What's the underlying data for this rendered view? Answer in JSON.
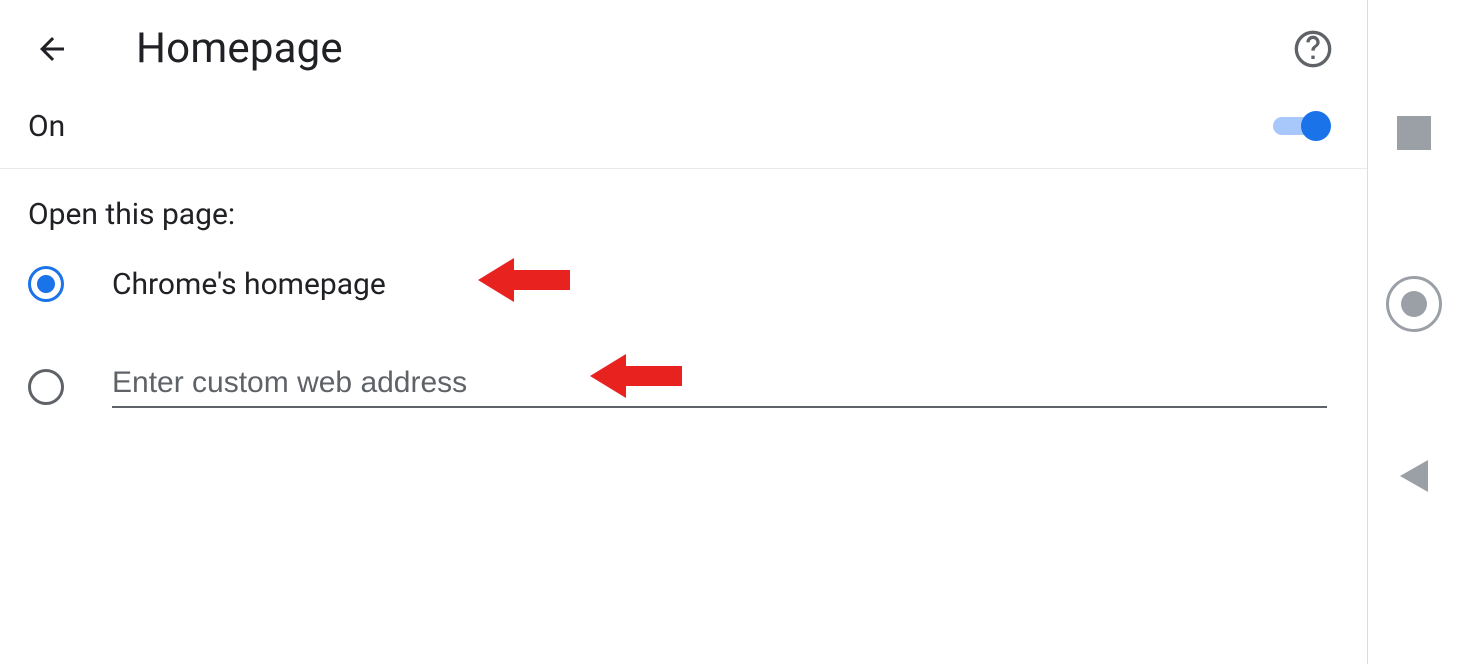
{
  "header": {
    "title": "Homepage"
  },
  "toggle": {
    "label": "On",
    "state": "on"
  },
  "section": {
    "label": "Open this page:"
  },
  "options": {
    "chrome": {
      "label": "Chrome's homepage",
      "selected": true
    },
    "custom": {
      "placeholder": "Enter custom web address",
      "value": "",
      "selected": false
    }
  },
  "annotations": {
    "arrow_color": "#e8221f"
  },
  "sidebar": {
    "icons": [
      "stop",
      "record",
      "play-back"
    ]
  }
}
